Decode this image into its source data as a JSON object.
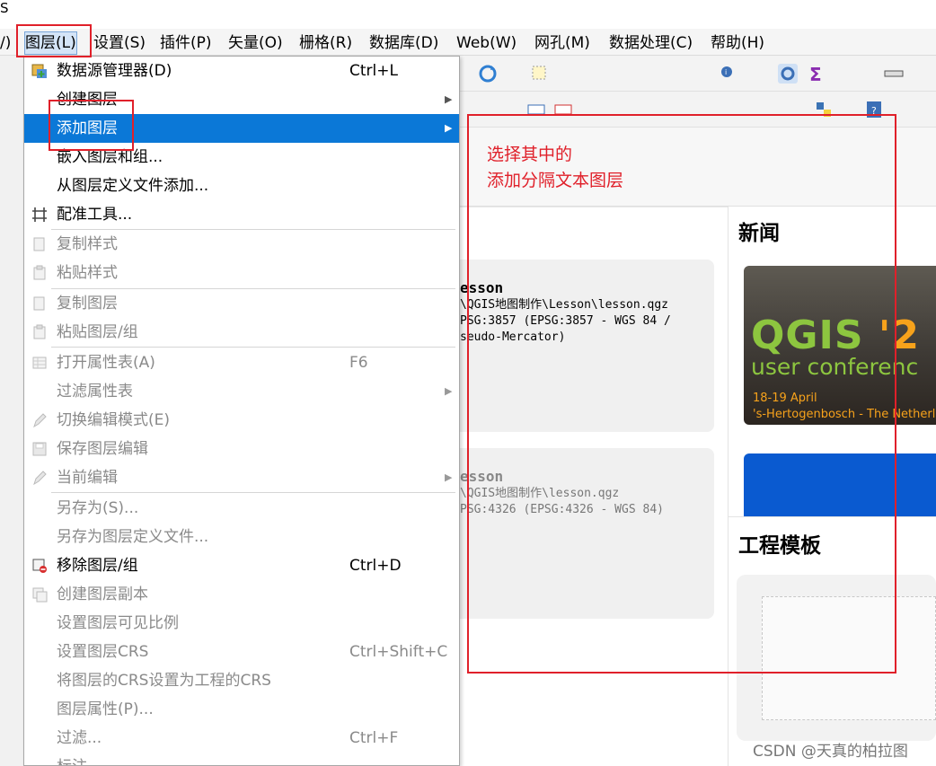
{
  "title_fragment": "S",
  "menubar": {
    "items": [
      {
        "name": "menu-view-partial",
        "label": "/)"
      },
      {
        "name": "menu-layer",
        "label": "图层(L)"
      },
      {
        "name": "menu-settings",
        "label": "设置(S)"
      },
      {
        "name": "menu-plugins",
        "label": "插件(P)"
      },
      {
        "name": "menu-vector",
        "label": "矢量(O)"
      },
      {
        "name": "menu-raster",
        "label": "栅格(R)"
      },
      {
        "name": "menu-database",
        "label": "数据库(D)"
      },
      {
        "name": "menu-web",
        "label": "Web(W)"
      },
      {
        "name": "menu-mesh",
        "label": "网孔(M)"
      },
      {
        "name": "menu-processing",
        "label": "数据处理(C)"
      },
      {
        "name": "menu-help",
        "label": "帮助(H)"
      }
    ]
  },
  "layer_menu": {
    "items": [
      {
        "label": "数据源管理器(D)",
        "shortcut": "Ctrl+L",
        "icon": "datasource-manager-icon"
      },
      {
        "label": "创建图层",
        "submenu": true
      },
      {
        "label": "添加图层",
        "submenu": true,
        "highlighted": true
      },
      {
        "label": "嵌入图层和组..."
      },
      {
        "label": "从图层定义文件添加..."
      },
      {
        "label": "配准工具...",
        "icon": "georeferencer-icon"
      },
      {
        "label": "复制样式",
        "disabled": true,
        "icon": "copy-style-icon"
      },
      {
        "label": "粘贴样式",
        "disabled": true,
        "icon": "paste-style-icon"
      },
      {
        "label": "复制图层",
        "disabled": true,
        "icon": "copy-layer-icon"
      },
      {
        "label": "粘贴图层/组",
        "disabled": true,
        "icon": "paste-layer-icon"
      },
      {
        "label": "打开属性表(A)",
        "shortcut": "F6",
        "disabled": true,
        "icon": "attribute-table-icon"
      },
      {
        "label": "过滤属性表",
        "submenu": true,
        "disabled": true
      },
      {
        "label": "切换编辑模式(E)",
        "disabled": true,
        "icon": "pencil-icon"
      },
      {
        "label": "保存图层编辑",
        "disabled": true,
        "icon": "save-edits-icon"
      },
      {
        "label": "当前编辑",
        "submenu": true,
        "disabled": true,
        "icon": "current-edits-icon"
      },
      {
        "label": "另存为(S)...",
        "disabled": true
      },
      {
        "label": "另存为图层定义文件...",
        "disabled": true
      },
      {
        "label": "移除图层/组",
        "shortcut": "Ctrl+D",
        "icon": "remove-layer-icon"
      },
      {
        "label": "创建图层副本",
        "disabled": true,
        "icon": "duplicate-layer-icon"
      },
      {
        "label": "设置图层可见比例",
        "disabled": true
      },
      {
        "label": "设置图层CRS",
        "shortcut": "Ctrl+Shift+C",
        "disabled": true
      },
      {
        "label": "将图层的CRS设置为工程的CRS",
        "disabled": true
      },
      {
        "label": "图层属性(P)...",
        "disabled": true
      },
      {
        "label": "过滤...",
        "shortcut": "Ctrl+F",
        "disabled": true
      },
      {
        "label": "标注",
        "disabled": true
      }
    ]
  },
  "recent_projects": [
    {
      "title": "esson",
      "path": "\\QGIS地图制作\\Lesson\\lesson.qgz",
      "crs1": "PSG:3857 (EPSG:3857 - WGS 84 /",
      "crs2": "seudo-Mercator)"
    },
    {
      "title": "esson",
      "path": "\\QGIS地图制作\\lesson.qgz",
      "crs1": "PSG:4326 (EPSG:4326 - WGS 84)"
    }
  ],
  "news": {
    "title": "新闻",
    "banner_qgis": "QGIS",
    "banner_year": " '2",
    "banner_line2": "user conferenc",
    "banner_date": "18-19 April",
    "banner_place": "'s-Hertogenbosch - The Netherla"
  },
  "templates": {
    "title": "工程模板"
  },
  "annotation": {
    "line1": "选择其中的",
    "line2": "添加分隔文本图层"
  },
  "watermark": "CSDN @天真的柏拉图",
  "colors": {
    "annotation_red": "#e0202a",
    "highlight_blue": "#0b78d7"
  }
}
